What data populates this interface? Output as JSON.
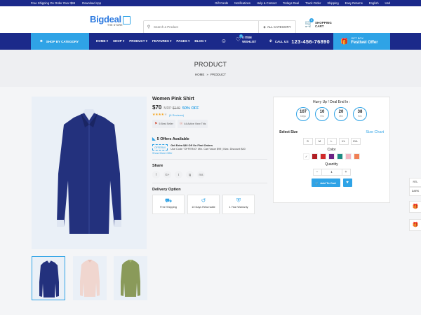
{
  "topbar": {
    "left": [
      "Free Shipping On Order Over $99",
      "Download App"
    ],
    "right": [
      "Gift Cards",
      "Notifications",
      "Help & Contact",
      "Todays Deal",
      "Track Order",
      "Shipping",
      "Easy Returns",
      "English",
      "Usd"
    ]
  },
  "logo": {
    "name": "Bigdeal",
    "sub": "THE STORE"
  },
  "search": {
    "placeholder": "Search a Product",
    "category": "ALL CATEGORY"
  },
  "cart": {
    "count": "0",
    "line1": "SHOPPING",
    "line2": "CART"
  },
  "nav": {
    "shop_by_category": "SHOP BY CATEGORY",
    "menu": [
      "HOME",
      "SHOP",
      "PRODUCT",
      "FEATURES",
      "PAGES",
      "BLOG"
    ],
    "wishlist_count": "0",
    "wishlist_line1": "0 ITEM",
    "wishlist_line2": "WISHLIST",
    "call_label": "CALL US",
    "phone": "123-456-76890",
    "gift_line1": "GIFT BOX",
    "gift_line2": "Festivel Offer"
  },
  "page": {
    "title": "PRODUCT",
    "breadcrumb": [
      "HOME",
      "PRODUCT"
    ]
  },
  "product": {
    "title": "Women Pink Shirt",
    "price": "$70",
    "mrp_label": "MRP",
    "mrp": "$140",
    "discount": "50% OFF",
    "reviews": "(6 Reviews)",
    "rating": 4,
    "rating_max": 5,
    "badges": [
      "5 Best Seller",
      "44 Active View This"
    ],
    "offers_title": "5 Offers Available",
    "offer_code": "OFFER40",
    "offer_title": "Get Extra $40 Off On First Orders",
    "offer_desc": "Use Code \"OFFER40\" Min. Cart Value $99 | Max. Discount $40",
    "more_offer": "Show More Offer",
    "share_title": "Share",
    "socials": [
      "f",
      "G+",
      "t",
      "ig",
      "rss"
    ],
    "delivery_title": "Delivery Option",
    "delivery": [
      "Free Shipping",
      "10 Days Returnable",
      "1 Year Warranty"
    ]
  },
  "panel": {
    "hurry": "Hurry Up ! Deal End In :",
    "timer": [
      {
        "value": "107",
        "unit": "Days"
      },
      {
        "value": "10",
        "unit": "Hrs"
      },
      {
        "value": "20",
        "unit": "Min"
      },
      {
        "value": "38",
        "unit": "Sec"
      }
    ],
    "select_size": "Select Size",
    "size_chart": "Size Chart",
    "sizes": [
      "S",
      "M",
      "L",
      "XL",
      "2XL"
    ],
    "color_label": "Color",
    "colors": [
      "#ffffff",
      "#b11f24",
      "#d12a2a",
      "#6d2285",
      "#1f8c84",
      "#f4b6c2",
      "#f08055"
    ],
    "quantity_label": "Quantity",
    "quantity": "1",
    "add_to_cart": "Add To Cart"
  },
  "sidebar": {
    "rtl": "RTL",
    "dark": "DARK"
  }
}
